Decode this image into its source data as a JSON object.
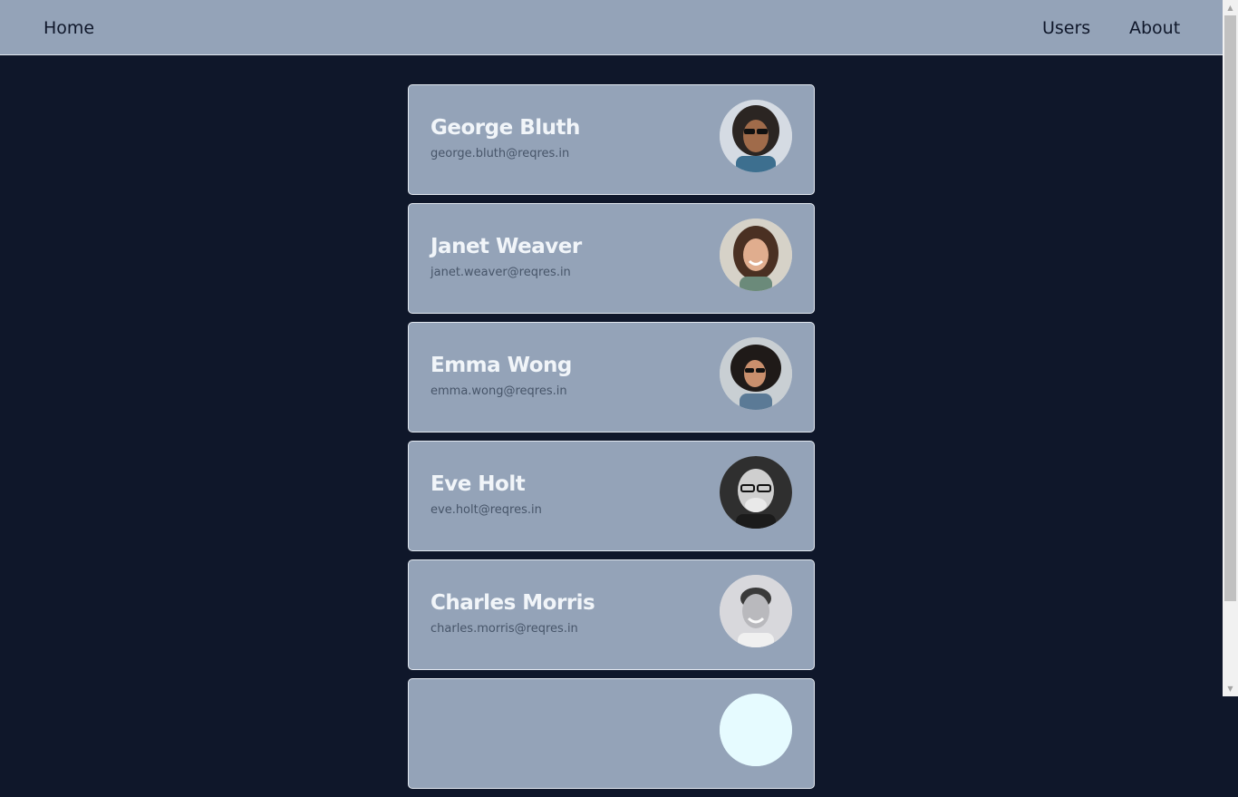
{
  "nav": {
    "home_label": "Home",
    "users_label": "Users",
    "about_label": "About"
  },
  "users": [
    {
      "name": "George Bluth",
      "email": "george.bluth@reqres.in",
      "avatar_icon": "avatar-photo"
    },
    {
      "name": "Janet Weaver",
      "email": "janet.weaver@reqres.in",
      "avatar_icon": "avatar-photo"
    },
    {
      "name": "Emma Wong",
      "email": "emma.wong@reqres.in",
      "avatar_icon": "avatar-photo"
    },
    {
      "name": "Eve Holt",
      "email": "eve.holt@reqres.in",
      "avatar_icon": "avatar-photo"
    },
    {
      "name": "Charles Morris",
      "email": "charles.morris@reqres.in",
      "avatar_icon": "avatar-photo"
    },
    {
      "name": "",
      "email": "",
      "avatar_icon": "avatar-photo"
    }
  ],
  "colors": {
    "background": "#0f172a",
    "navbar": "#94a3b8",
    "card": "#94a3b8",
    "card_border": "#e2e8f0",
    "name_text": "#f1f5f9",
    "email_text": "#475569"
  }
}
